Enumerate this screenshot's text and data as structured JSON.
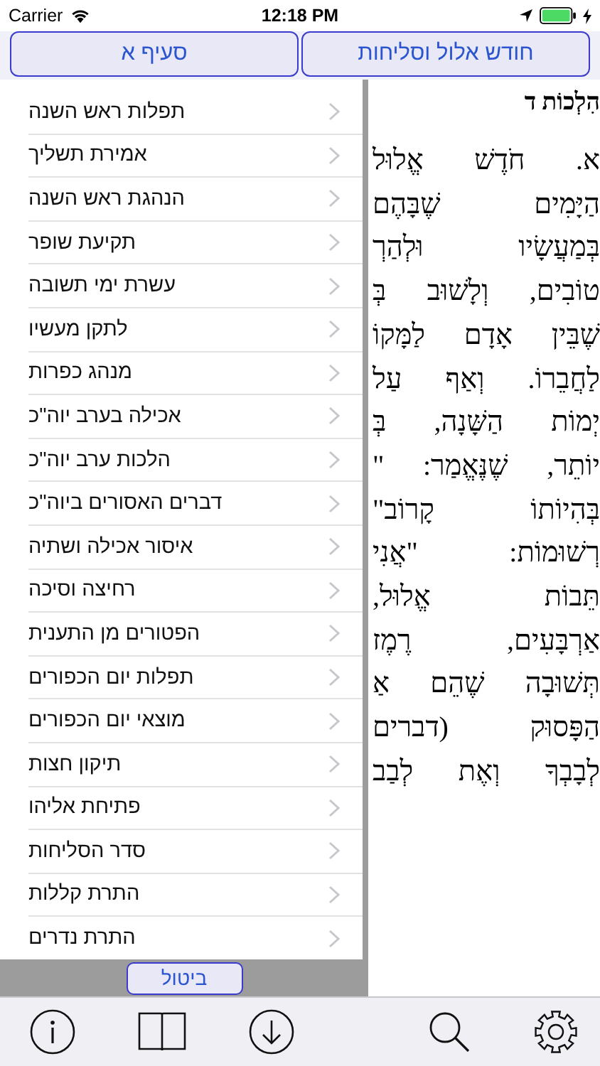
{
  "status_bar": {
    "carrier": "Carrier",
    "time": "12:18 PM"
  },
  "header_buttons": [
    {
      "label": "חודש אלול וסליחות"
    },
    {
      "label": "סעיף א"
    }
  ],
  "chapter_list": {
    "items": [
      "תפלות ראש השנה",
      "אמירת תשליך",
      "הנהגת ראש השנה",
      "תקיעת שופר",
      "עשרת ימי תשובה",
      "לתקן מעשיו",
      "מנהג כפרות",
      "אכילה בערב יוה\"כ",
      "הלכות ערב יוה\"כ",
      "דברים האסורים ביוה\"כ",
      "איסור אכילה ושתיה",
      "רחיצה וסיכה",
      "הפטורים מן התענית",
      "תפלות יום הכפורים",
      "מוצאי יום הכפורים",
      "תיקון חצות",
      "פתיחת אליהו",
      "סדר הסליחות",
      "התרת קללות",
      "התרת נדרים"
    ],
    "cancel_button": "ביטול"
  },
  "text_view": {
    "title": "הִלְכוֹת ד",
    "lines": [
      "א. חֹדֶשׁ אֱלוּל",
      "הַיָּמִים שֶׁבָּהֶם",
      "בְּמַעֲשָׂיו וּלְהַרְ",
      "טוֹבִים, וְלָשׁוּב בְּ",
      "שֶׁבֵּין אָדָם לַמָּקוֹ",
      "לַחֲבֵרוֹ. וְאַף עַל",
      "יְמוֹת הַשָּׁנָה, בְּ",
      "יוֹתֵר, שֶׁנֶּאֱמַר: \"",
      "בְּהִיוֹתוֹ קָרוֹב\"",
      "רְשׁוּמוֹת: \"אֲנִי",
      "תֵּבוֹת אֱלוּל,",
      "אַרְבָּעִים, רֶמֶז",
      "תְּשׁוּבָה שֶׁהֵם אַ",
      "הַפָּסוּק (דברים",
      "לְבָבְךָ וְאֶת לְבַב"
    ]
  }
}
